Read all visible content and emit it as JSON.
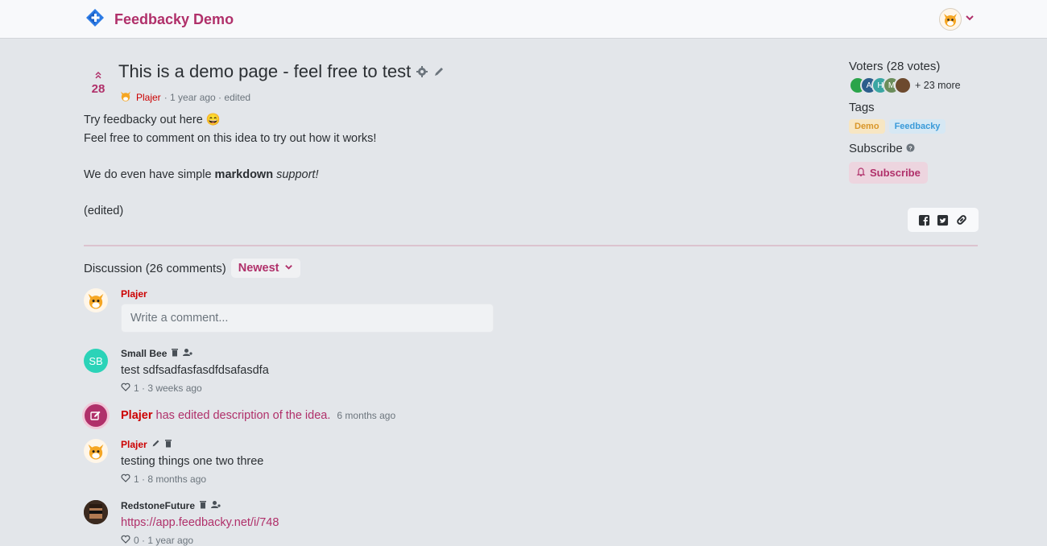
{
  "header": {
    "brand": "Feedbacky Demo",
    "icons": [
      "feedbacky-logo-icon",
      "user-avatar",
      "chevron-down-icon"
    ]
  },
  "idea": {
    "votes": "28",
    "title": "This is a demo page - feel free to test",
    "author": "Plajer",
    "meta": "· 1 year ago · edited",
    "line1": "Try feedbacky out here",
    "line1_emoji": "😄",
    "line2": "Feel free to comment on this idea to try out how it works!",
    "line3_pre": "We do even have simple ",
    "line3_bold": "markdown",
    "line3_italic": "support!",
    "line4": "(edited)"
  },
  "sidebar": {
    "voters_title": "Voters (28 votes)",
    "voter_initials": [
      "",
      "A",
      "H",
      "M",
      ""
    ],
    "more": "+ 23 more",
    "tags_title": "Tags",
    "tags": [
      {
        "label": "Demo",
        "bg": "#f7e6c3",
        "color": "#d9962a"
      },
      {
        "label": "Feedbacky",
        "bg": "#d6e8f4",
        "color": "#3a9ad9"
      }
    ],
    "subscribe_title": "Subscribe",
    "subscribe_label": "Subscribe"
  },
  "discussion": {
    "title": "Discussion (26 comments)",
    "sort_label": "Newest",
    "me": "Plajer",
    "input_placeholder": "Write a comment...",
    "comments": [
      {
        "author": "Small Bee",
        "initials": "SB",
        "text": "test sdfsadfasfasdfdsafasdfa",
        "meta": "1 · 3 weeks ago"
      },
      {
        "author": "Plajer",
        "text": "testing things one two three",
        "meta": "1 · 8 months ago"
      },
      {
        "author": "RedstoneFuture",
        "text": "https://app.feedbacky.net/i/748",
        "meta": "0 · 1 year ago"
      }
    ],
    "edit_event": {
      "author": "Plajer",
      "action": "has edited description of the idea.",
      "time": "6 months ago"
    }
  },
  "colors": {
    "accent": "#b0306a",
    "author_red": "#cc0000",
    "small_bee": "#2bd3b8"
  }
}
